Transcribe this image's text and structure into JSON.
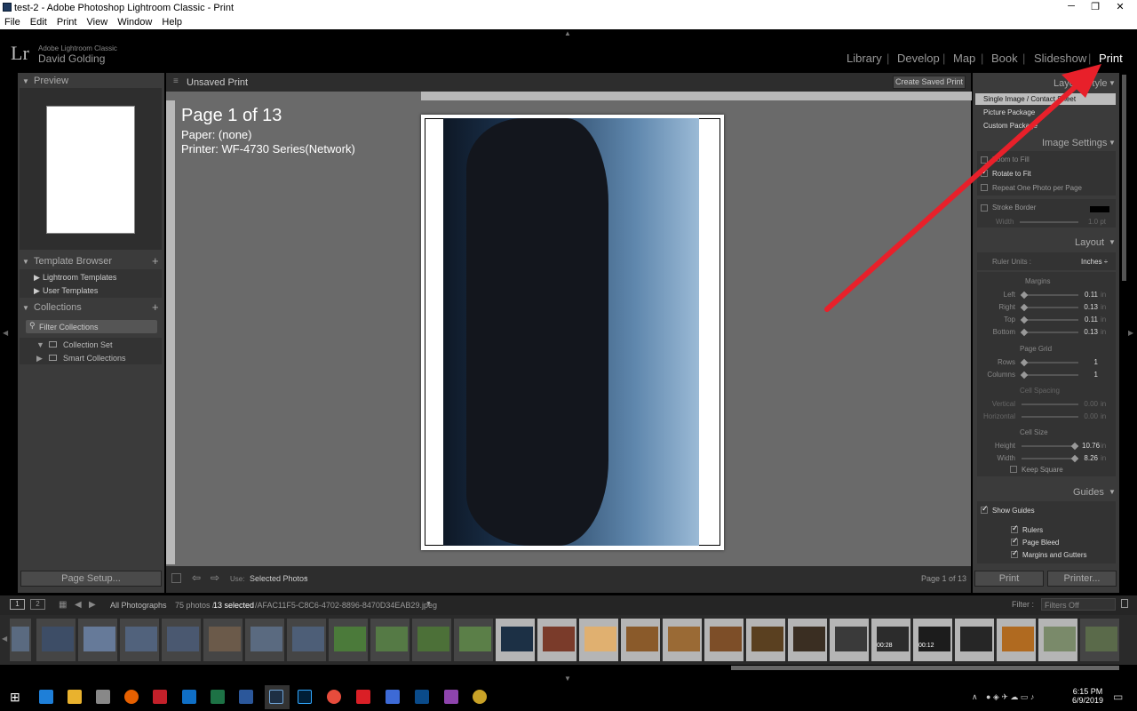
{
  "window": {
    "title": "test-2 - Adobe Photoshop Lightroom Classic - Print",
    "minimize": "─",
    "restore": "❐",
    "close": "✕"
  },
  "menu": [
    "File",
    "Edit",
    "Print",
    "View",
    "Window",
    "Help"
  ],
  "identity": {
    "logo": "Lr",
    "product": "Adobe Lightroom Classic",
    "user": "David Golding"
  },
  "modules": [
    "Library",
    "Develop",
    "Map",
    "Book",
    "Slideshow",
    "Print"
  ],
  "active_module": "Print",
  "left": {
    "preview": "Preview",
    "template_browser": "Template Browser",
    "templates": [
      "Lightroom Templates",
      "User Templates"
    ],
    "collections": "Collections",
    "filter": "Filter Collections",
    "collection_items": [
      "Collection Set",
      "Smart Collections"
    ],
    "page_setup": "Page Setup..."
  },
  "center": {
    "print_name": "Unsaved Print",
    "create_saved": "Create Saved Print",
    "page_title": "Page 1 of 13",
    "paper": "Paper:  (none)",
    "printer": "Printer:  WF-4730 Series(Network)",
    "use_label": "Use:",
    "use_value": "Selected Photos",
    "page_counter": "Page 1 of 13"
  },
  "right": {
    "layout_style": "Layout Style",
    "styles": [
      "Single Image / Contact Sheet",
      "Picture Package",
      "Custom Package"
    ],
    "image_settings": "Image Settings",
    "img_opts": [
      {
        "label": "Zoom to Fill",
        "checked": false
      },
      {
        "label": "Rotate to Fit",
        "checked": true
      },
      {
        "label": "Repeat One Photo per Page",
        "checked": false
      }
    ],
    "stroke_border": "Stroke Border",
    "width_label": "Width",
    "width_val": "1.0 pt",
    "layout": "Layout",
    "ruler_units_label": "Ruler Units :",
    "ruler_units_val": "Inches ÷",
    "margins": "Margins",
    "margin_rows": [
      {
        "label": "Left",
        "value": "0.11",
        "unit": "in"
      },
      {
        "label": "Right",
        "value": "0.13",
        "unit": "in"
      },
      {
        "label": "Top",
        "value": "0.11",
        "unit": "in"
      },
      {
        "label": "Bottom",
        "value": "0.13",
        "unit": "in"
      }
    ],
    "page_grid": "Page Grid",
    "grid_rows": [
      {
        "label": "Rows",
        "value": "1"
      },
      {
        "label": "Columns",
        "value": "1"
      }
    ],
    "cell_spacing": "Cell Spacing",
    "spacing_rows": [
      {
        "label": "Vertical",
        "value": "0.00",
        "unit": "in"
      },
      {
        "label": "Horizontal",
        "value": "0.00",
        "unit": "in"
      }
    ],
    "cell_size": "Cell Size",
    "size_rows": [
      {
        "label": "Height",
        "value": "10.76",
        "unit": "in"
      },
      {
        "label": "Width",
        "value": "8.26",
        "unit": "in"
      }
    ],
    "keep_square": "Keep Square",
    "guides": "Guides",
    "show_guides": "Show Guides",
    "guide_opts": [
      "Rulers",
      "Page Bleed",
      "Margins and Gutters"
    ],
    "print_btn": "Print",
    "printer_btn": "Printer..."
  },
  "filmstrip": {
    "screen1": "1",
    "screen2": "2",
    "source": "All Photographs",
    "count_prefix": "75 photos /",
    "selected": "13 selected",
    "filename": "/AFAC11F5-C8C6-4702-8896-8470D34EAB29.jpeg",
    "filter_label": "Filter :",
    "filter_val": "Filters Off",
    "durations": [
      "00:28",
      "00:12"
    ]
  },
  "taskbar": {
    "time": "6:15 PM",
    "date": "6/9/2019"
  },
  "colors": {
    "arrow": "#e8202a",
    "bg_panel": "#3b3b3b",
    "center": "#6a6a6a"
  }
}
